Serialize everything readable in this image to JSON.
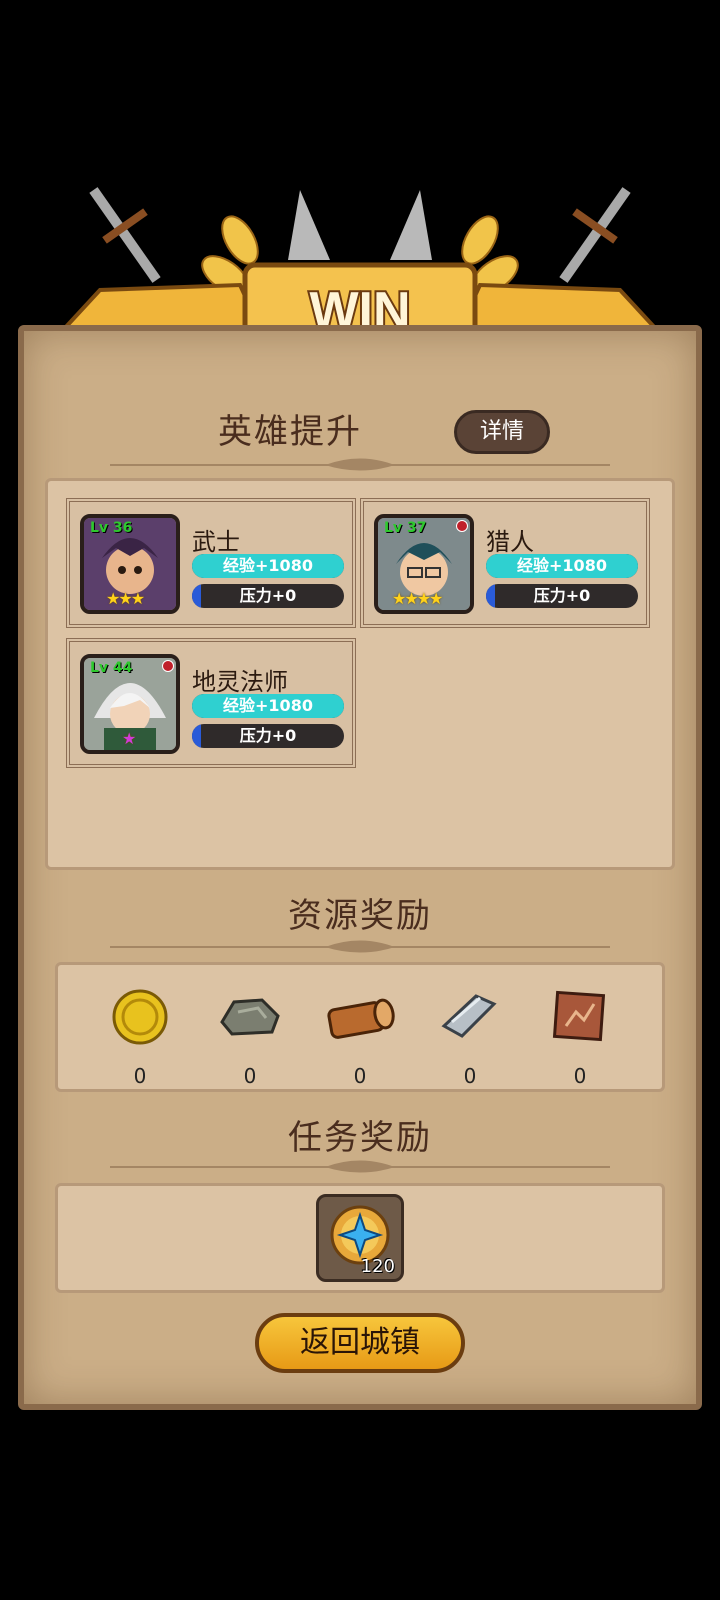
{
  "banner": {
    "title": "WIN"
  },
  "sections": {
    "hero_upgrade": "英雄提升",
    "detail_button": "详情",
    "resource_rewards": "资源奖励",
    "task_rewards": "任务奖励"
  },
  "heroes": [
    {
      "name": "武士",
      "level": "Lv 36",
      "stars": "★★★",
      "exp": "经验+1080",
      "pressure": "压力+0",
      "badge": false
    },
    {
      "name": "猎人",
      "level": "Lv 37",
      "stars": "★★★★",
      "exp": "经验+1080",
      "pressure": "压力+0",
      "badge": true
    },
    {
      "name": "地灵法师",
      "level": "Lv 44",
      "stars": "★",
      "exp": "经验+1080",
      "pressure": "压力+0",
      "badge": true
    }
  ],
  "resources": [
    {
      "icon": "gold-coin-icon",
      "count": "0"
    },
    {
      "icon": "stone-icon",
      "count": "0"
    },
    {
      "icon": "wood-log-icon",
      "count": "0"
    },
    {
      "icon": "iron-ingot-icon",
      "count": "0"
    },
    {
      "icon": "leather-icon",
      "count": "0"
    }
  ],
  "task_reward": {
    "icon": "star-medal-icon",
    "quantity": "120"
  },
  "return_button": "返回城镇",
  "colors": {
    "exp_bar": "#2fd0d0",
    "pressure_bar": "#2a5bd8",
    "panel": "#cbae87",
    "ribbon": "#f0b53a"
  }
}
